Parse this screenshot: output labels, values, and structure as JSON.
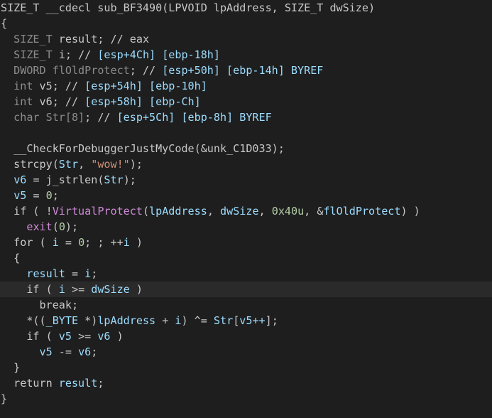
{
  "lines": [
    [
      {
        "t": "SIZE_T __cdecl sub_BF3490(LPVOID lpAddress, SIZE_T dwSize)",
        "c": "plain"
      }
    ],
    [
      {
        "t": "{",
        "c": "plain"
      }
    ],
    [
      {
        "t": "  SIZE_T ",
        "c": "dim"
      },
      {
        "t": "result",
        "c": "plain"
      },
      {
        "t": "; // eax",
        "c": "plain"
      }
    ],
    [
      {
        "t": "  SIZE_T ",
        "c": "dim"
      },
      {
        "t": "i",
        "c": "plain"
      },
      {
        "t": "; // ",
        "c": "plain"
      },
      {
        "t": "[esp+4Ch] [ebp-18h]",
        "c": "var"
      }
    ],
    [
      {
        "t": "  DWORD ",
        "c": "dim"
      },
      {
        "t": "flOldProtect",
        "c": "dim"
      },
      {
        "t": "; // ",
        "c": "plain"
      },
      {
        "t": "[esp+50h] [ebp-14h] BYREF",
        "c": "var"
      }
    ],
    [
      {
        "t": "  int ",
        "c": "dim"
      },
      {
        "t": "v5",
        "c": "plain"
      },
      {
        "t": "; // ",
        "c": "plain"
      },
      {
        "t": "[esp+54h] [ebp-10h]",
        "c": "var"
      }
    ],
    [
      {
        "t": "  int ",
        "c": "dim"
      },
      {
        "t": "v6",
        "c": "plain"
      },
      {
        "t": "; // ",
        "c": "plain"
      },
      {
        "t": "[esp+58h] [ebp-Ch]",
        "c": "var"
      }
    ],
    [
      {
        "t": "  char ",
        "c": "dim"
      },
      {
        "t": "Str[8]",
        "c": "dim"
      },
      {
        "t": "; // ",
        "c": "plain"
      },
      {
        "t": "[esp+5Ch] [ebp-8h] BYREF",
        "c": "var"
      }
    ],
    [
      {
        "t": "",
        "c": "plain"
      }
    ],
    [
      {
        "t": "  __CheckForDebuggerJustMyCode(&unk_C1D033);",
        "c": "plain"
      }
    ],
    [
      {
        "t": "  strcpy(",
        "c": "plain"
      },
      {
        "t": "Str",
        "c": "var"
      },
      {
        "t": ", ",
        "c": "plain"
      },
      {
        "t": "\"wow!\"",
        "c": "str"
      },
      {
        "t": ");",
        "c": "plain"
      }
    ],
    [
      {
        "t": "  ",
        "c": "plain"
      },
      {
        "t": "v6",
        "c": "var"
      },
      {
        "t": " = j_strlen(",
        "c": "plain"
      },
      {
        "t": "Str",
        "c": "var"
      },
      {
        "t": ");",
        "c": "plain"
      }
    ],
    [
      {
        "t": "  ",
        "c": "plain"
      },
      {
        "t": "v5",
        "c": "var"
      },
      {
        "t": " = ",
        "c": "plain"
      },
      {
        "t": "0",
        "c": "num"
      },
      {
        "t": ";",
        "c": "plain"
      }
    ],
    [
      {
        "t": "  if ( !",
        "c": "plain"
      },
      {
        "t": "VirtualProtect",
        "c": "api"
      },
      {
        "t": "(",
        "c": "plain"
      },
      {
        "t": "lpAddress",
        "c": "var"
      },
      {
        "t": ", ",
        "c": "plain"
      },
      {
        "t": "dwSize",
        "c": "var"
      },
      {
        "t": ", ",
        "c": "plain"
      },
      {
        "t": "0x40u",
        "c": "num"
      },
      {
        "t": ", &",
        "c": "plain"
      },
      {
        "t": "flOldProtect",
        "c": "var"
      },
      {
        "t": ") )",
        "c": "plain"
      }
    ],
    [
      {
        "t": "    ",
        "c": "plain"
      },
      {
        "t": "exit",
        "c": "api"
      },
      {
        "t": "(",
        "c": "plain"
      },
      {
        "t": "0",
        "c": "num"
      },
      {
        "t": ");",
        "c": "plain"
      }
    ],
    [
      {
        "t": "  for ( ",
        "c": "plain"
      },
      {
        "t": "i",
        "c": "var"
      },
      {
        "t": " = ",
        "c": "plain"
      },
      {
        "t": "0",
        "c": "num"
      },
      {
        "t": "; ; ++",
        "c": "plain"
      },
      {
        "t": "i",
        "c": "var"
      },
      {
        "t": " )",
        "c": "plain"
      }
    ],
    [
      {
        "t": "  {",
        "c": "plain"
      }
    ],
    [
      {
        "t": "    ",
        "c": "plain"
      },
      {
        "t": "result",
        "c": "var"
      },
      {
        "t": " = ",
        "c": "plain"
      },
      {
        "t": "i",
        "c": "var"
      },
      {
        "t": ";",
        "c": "plain"
      }
    ],
    [
      {
        "t": "    if ( ",
        "c": "plain"
      },
      {
        "t": "i",
        "c": "var"
      },
      {
        "t": " >= ",
        "c": "plain"
      },
      {
        "t": "dwSize",
        "c": "var"
      },
      {
        "t": " )",
        "c": "plain"
      }
    ],
    [
      {
        "t": "      break;",
        "c": "plain"
      }
    ],
    [
      {
        "t": "    *((",
        "c": "plain"
      },
      {
        "t": "_BYTE",
        "c": "var"
      },
      {
        "t": " *)",
        "c": "plain"
      },
      {
        "t": "lpAddress",
        "c": "var"
      },
      {
        "t": " + ",
        "c": "plain"
      },
      {
        "t": "i",
        "c": "var"
      },
      {
        "t": ") ^= ",
        "c": "plain"
      },
      {
        "t": "Str",
        "c": "var"
      },
      {
        "t": "[",
        "c": "plain"
      },
      {
        "t": "v5++",
        "c": "var"
      },
      {
        "t": "];",
        "c": "plain"
      }
    ],
    [
      {
        "t": "    if ( ",
        "c": "plain"
      },
      {
        "t": "v5",
        "c": "var"
      },
      {
        "t": " >= ",
        "c": "plain"
      },
      {
        "t": "v6",
        "c": "var"
      },
      {
        "t": " )",
        "c": "plain"
      }
    ],
    [
      {
        "t": "      ",
        "c": "plain"
      },
      {
        "t": "v5",
        "c": "var"
      },
      {
        "t": " -= ",
        "c": "plain"
      },
      {
        "t": "v6",
        "c": "var"
      },
      {
        "t": ";",
        "c": "plain"
      }
    ],
    [
      {
        "t": "  }",
        "c": "plain"
      }
    ],
    [
      {
        "t": "  return ",
        "c": "plain"
      },
      {
        "t": "result",
        "c": "var"
      },
      {
        "t": ";",
        "c": "plain"
      }
    ],
    [
      {
        "t": "}",
        "c": "plain"
      }
    ]
  ],
  "highlighted_line": 18,
  "colors": {
    "background": "#1e1e1e",
    "highlight": "#2a2a2a",
    "plain": "#c8c8c8",
    "dim": "#8c8c8c",
    "var": "#9cdcfe",
    "api": "#ce8ad6",
    "num": "#b5cea8",
    "str": "#ce9178"
  }
}
